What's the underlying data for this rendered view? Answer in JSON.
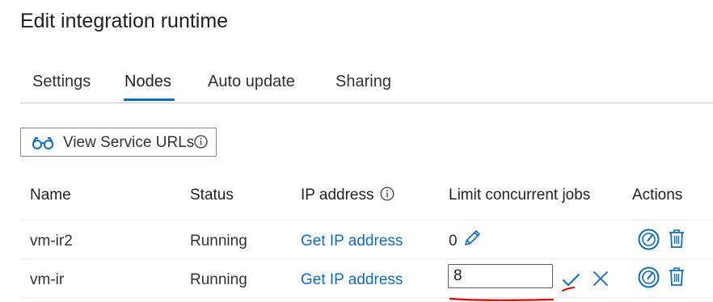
{
  "page": {
    "title": "Edit integration runtime"
  },
  "tabs": [
    {
      "label": "Settings",
      "active": false
    },
    {
      "label": "Nodes",
      "active": true
    },
    {
      "label": "Auto update",
      "active": false
    },
    {
      "label": "Sharing",
      "active": false
    }
  ],
  "toolbar": {
    "view_urls_label": "View Service URLs",
    "icon": "glasses-icon"
  },
  "table": {
    "headers": [
      "Name",
      "Status",
      "IP address",
      "Limit concurrent jobs",
      "Actions"
    ],
    "rows": [
      {
        "name": "vm-ir2",
        "status": "Running",
        "ip_link": "Get IP address",
        "jobs": "0",
        "editing": false
      },
      {
        "name": "vm-ir",
        "status": "Running",
        "ip_link": "Get IP address",
        "jobs": "8",
        "editing": true
      }
    ]
  },
  "colors": {
    "accent": "#0f6cbd",
    "annotation": "#e00000"
  }
}
